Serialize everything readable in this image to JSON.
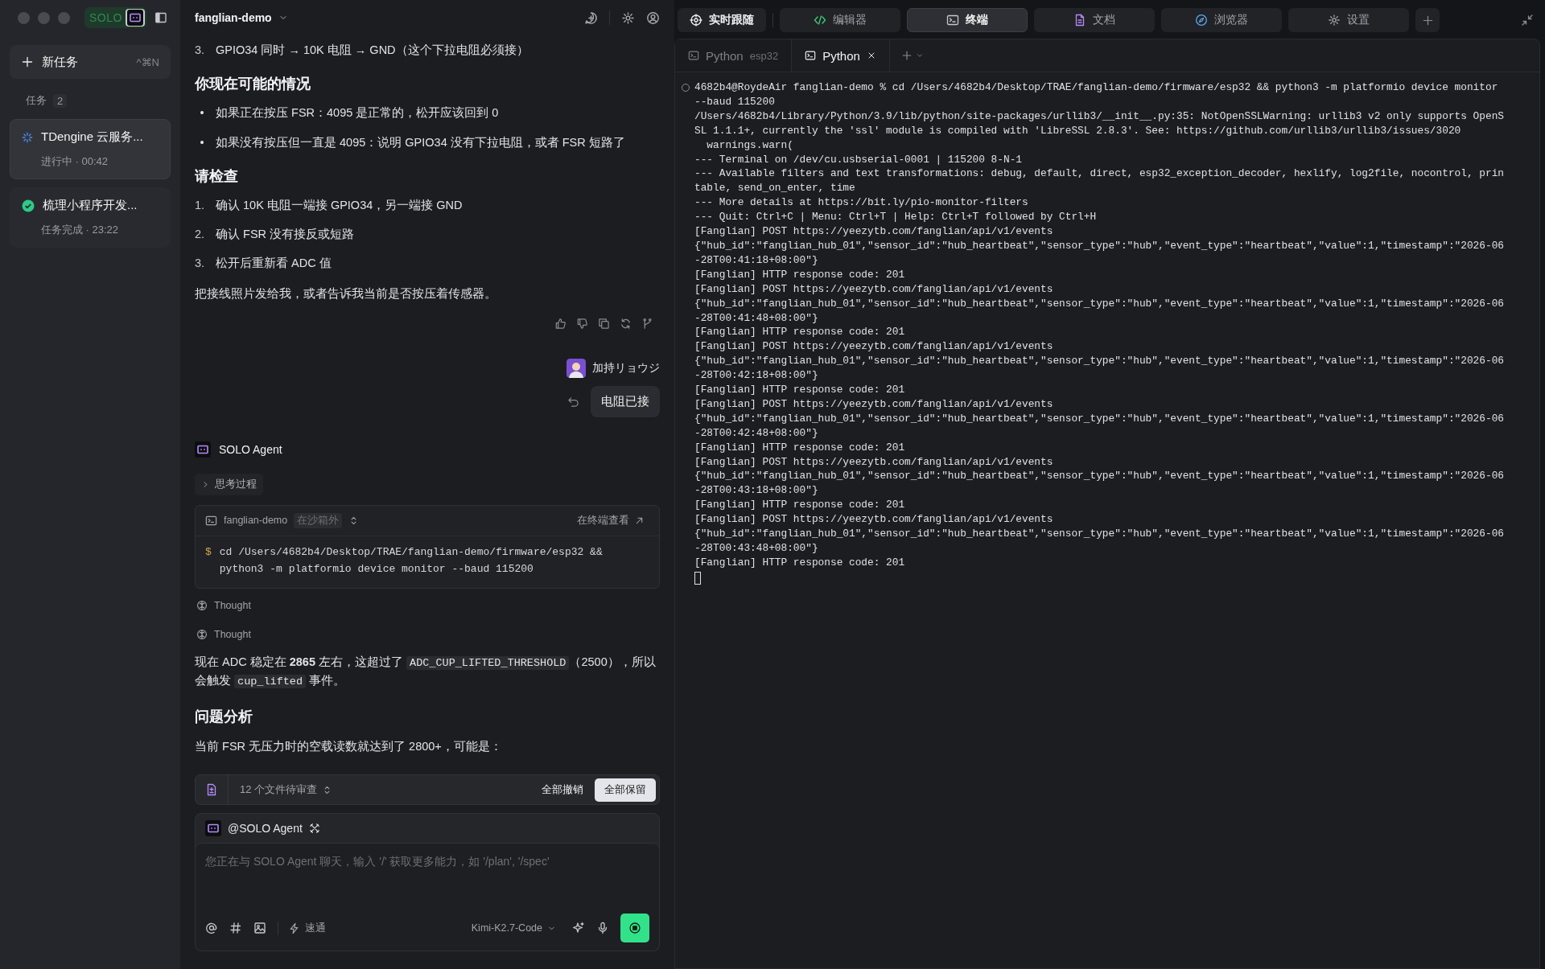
{
  "sidebar": {
    "logo": "SOLO",
    "new_task": {
      "label": "新任务",
      "shortcut": "^⌘N"
    },
    "tasks_header": {
      "label": "任务",
      "count": "2"
    },
    "tasks": [
      {
        "title": "TDengine 云服务...",
        "status": "进行中 · 00:42",
        "kind": "running",
        "selected": true
      },
      {
        "title": "梳理小程序开发...",
        "status": "任务完成 · 23:22",
        "kind": "done",
        "selected": false
      }
    ]
  },
  "chat": {
    "project": "fanglian-demo",
    "messages": [
      {
        "kind": "numbered",
        "number": "3.",
        "text": "GPIO34 同时 → 10K 电阻 → GND（这个下拉电阻必须接）"
      },
      {
        "kind": "heading",
        "text": "你现在可能的情况"
      },
      {
        "kind": "bullet",
        "marker": "•",
        "text": "如果正在按压 FSR：4095 是正常的，松开应该回到 0"
      },
      {
        "kind": "bullet",
        "marker": "•",
        "text": "如果没有按压但一直是 4095：说明 GPIO34 没有下拉电阻，或者 FSR 短路了"
      },
      {
        "kind": "heading",
        "text": "请检查"
      },
      {
        "kind": "numbered",
        "number": "1.",
        "text": "确认 10K 电阻一端接 GPIO34，另一端接 GND"
      },
      {
        "kind": "numbered",
        "number": "2.",
        "text": "确认 FSR 没有接反或短路"
      },
      {
        "kind": "numbered",
        "number": "3.",
        "text": "松开后重新看 ADC 值"
      },
      {
        "kind": "paragraph",
        "text": "把接线照片发给我，或者告诉我当前是否按压着传感器。"
      },
      {
        "kind": "actions"
      },
      {
        "kind": "user",
        "name": "加持リョウジ",
        "text": "电阻已接"
      },
      {
        "kind": "agent",
        "name": "SOLO Agent"
      },
      {
        "kind": "thinking",
        "label": "思考过程",
        "expanded": false
      },
      {
        "kind": "command",
        "project": "fanglian-demo",
        "badge": "在沙箱外",
        "link": "在终端查看",
        "prompt": "$",
        "command": "cd /Users/4682b4/Desktop/TRAE/fanglian-demo/firmware/esp32 && python3 -m platformio device monitor --baud 115200"
      },
      {
        "kind": "thought",
        "text": "Thought"
      },
      {
        "kind": "thought",
        "text": "Thought"
      },
      {
        "kind": "segments",
        "segments": [
          {
            "kind": "text",
            "text": "现在 ADC 稳定在 "
          },
          {
            "kind": "bold",
            "text": "2865"
          },
          {
            "kind": "text",
            "text": " 左右，这超过了 "
          },
          {
            "kind": "code",
            "text": "ADC_CUP_LIFTED_THRESHOLD"
          },
          {
            "kind": "text",
            "text": "（2500），所以会触发 "
          },
          {
            "kind": "code",
            "text": "cup_lifted"
          },
          {
            "kind": "text",
            "text": " 事件。"
          }
        ]
      },
      {
        "kind": "heading",
        "text": "问题分析"
      },
      {
        "kind": "paragraph",
        "text": "当前 FSR 无压力时的空载读数就达到了 2800+，可能是："
      }
    ],
    "review": {
      "label": "12 个文件待审查",
      "reject": "全部撤销",
      "accept": "全部保留"
    },
    "composer": {
      "mention": "@SOLO Agent",
      "placeholder": "您正在与 SOLO Agent 聊天，输入 '/' 获取更多能力，如 '/plan', '/spec'",
      "mode": "速通",
      "model": "Kimi-K2.7-Code"
    }
  },
  "panel": {
    "follow": "实时跟随",
    "tabs": [
      {
        "label": "编辑器",
        "selected": false
      },
      {
        "label": "终端",
        "selected": true
      },
      {
        "label": "文档",
        "selected": false
      },
      {
        "label": "浏览器",
        "selected": false
      },
      {
        "label": "设置",
        "selected": false
      }
    ]
  },
  "terminal": {
    "tabs": [
      {
        "label": "Python",
        "detail": "esp32",
        "selected": false
      },
      {
        "label": "Python",
        "selected": true
      }
    ],
    "lines": [
      "4682b4@RoydeAir fanglian-demo % cd /Users/4682b4/Desktop/TRAE/fanglian-demo/firmware/esp32 && python3 -m platformio device monitor",
      "--baud 115200",
      "/Users/4682b4/Library/Python/3.9/lib/python/site-packages/urllib3/__init__.py:35: NotOpenSSLWarning: urllib3 v2 only supports OpenS",
      "SL 1.1.1+, currently the 'ssl' module is compiled with 'LibreSSL 2.8.3'. See: https://github.com/urllib3/urllib3/issues/3020",
      "  warnings.warn(",
      "--- Terminal on /dev/cu.usbserial-0001 | 115200 8-N-1",
      "--- Available filters and text transformations: debug, default, direct, esp32_exception_decoder, hexlify, log2file, nocontrol, prin",
      "table, send_on_enter, time",
      "--- More details at https://bit.ly/pio-monitor-filters",
      "--- Quit: Ctrl+C | Menu: Ctrl+T | Help: Ctrl+T followed by Ctrl+H",
      "[Fanglian] POST https://yeezytb.com/fanglian/api/v1/events",
      "{\"hub_id\":\"fanglian_hub_01\",\"sensor_id\":\"hub_heartbeat\",\"sensor_type\":\"hub\",\"event_type\":\"heartbeat\",\"value\":1,\"timestamp\":\"2026-06",
      "-28T00:41:18+08:00\"}",
      "[Fanglian] HTTP response code: 201",
      "[Fanglian] POST https://yeezytb.com/fanglian/api/v1/events",
      "{\"hub_id\":\"fanglian_hub_01\",\"sensor_id\":\"hub_heartbeat\",\"sensor_type\":\"hub\",\"event_type\":\"heartbeat\",\"value\":1,\"timestamp\":\"2026-06",
      "-28T00:41:48+08:00\"}",
      "[Fanglian] HTTP response code: 201",
      "[Fanglian] POST https://yeezytb.com/fanglian/api/v1/events",
      "{\"hub_id\":\"fanglian_hub_01\",\"sensor_id\":\"hub_heartbeat\",\"sensor_type\":\"hub\",\"event_type\":\"heartbeat\",\"value\":1,\"timestamp\":\"2026-06",
      "-28T00:42:18+08:00\"}",
      "[Fanglian] HTTP response code: 201",
      "[Fanglian] POST https://yeezytb.com/fanglian/api/v1/events",
      "{\"hub_id\":\"fanglian_hub_01\",\"sensor_id\":\"hub_heartbeat\",\"sensor_type\":\"hub\",\"event_type\":\"heartbeat\",\"value\":1,\"timestamp\":\"2026-06",
      "-28T00:42:48+08:00\"}",
      "[Fanglian] HTTP response code: 201",
      "[Fanglian] POST https://yeezytb.com/fanglian/api/v1/events",
      "{\"hub_id\":\"fanglian_hub_01\",\"sensor_id\":\"hub_heartbeat\",\"sensor_type\":\"hub\",\"event_type\":\"heartbeat\",\"value\":1,\"timestamp\":\"2026-06",
      "-28T00:43:18+08:00\"}",
      "[Fanglian] HTTP response code: 201",
      "[Fanglian] POST https://yeezytb.com/fanglian/api/v1/events",
      "{\"hub_id\":\"fanglian_hub_01\",\"sensor_id\":\"hub_heartbeat\",\"sensor_type\":\"hub\",\"event_type\":\"heartbeat\",\"value\":1,\"timestamp\":\"2026-06",
      "-28T00:43:48+08:00\"}",
      "[Fanglian] HTTP response code: 201"
    ]
  }
}
